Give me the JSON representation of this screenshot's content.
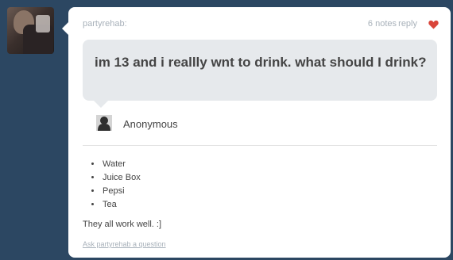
{
  "post": {
    "username": "partyrehab:",
    "notes": "6 notes",
    "reply_label": "reply",
    "question": "im 13 and i reallly wnt to drink. what should I drink?",
    "asker": "Anonymous",
    "answer_items": [
      "Water",
      "Juice Box",
      "Pepsi",
      "Tea"
    ],
    "answer_note": "They all work well. :]",
    "ask_link": "Ask partyrehab a question"
  },
  "colors": {
    "background": "#2c4762",
    "heart": "#d9453a",
    "question_bubble": "#e6e9ec"
  },
  "icons": {
    "like": "heart-icon",
    "asker": "anonymous-silhouette-icon",
    "avatar": "user-avatar"
  }
}
